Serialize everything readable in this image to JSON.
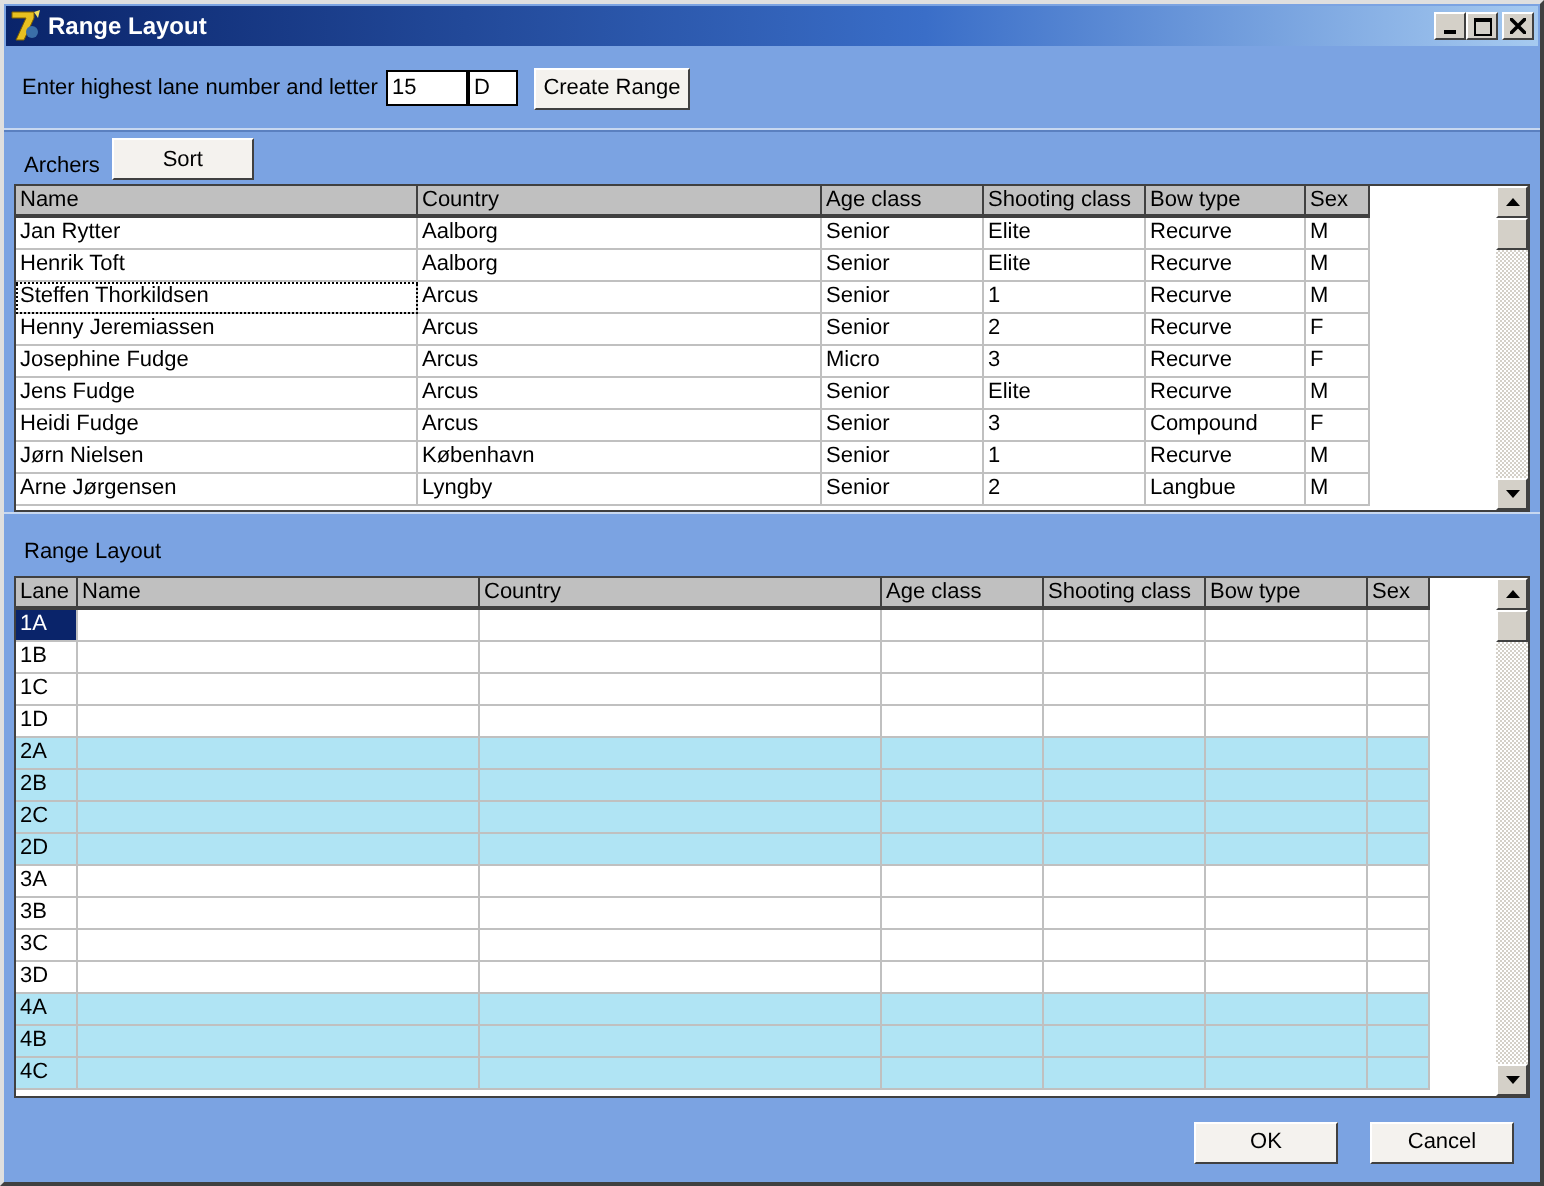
{
  "window": {
    "title": "Range Layout"
  },
  "range_input": {
    "label": "Enter highest lane number and letter",
    "number": "15",
    "letter": "D",
    "button": "Create Range"
  },
  "archers": {
    "label": "Archers",
    "sort_button": "Sort",
    "columns": [
      "Name",
      "Country",
      "Age class",
      "Shooting class",
      "Bow type",
      "Sex"
    ],
    "rows": [
      {
        "cells": [
          "Jan Rytter",
          "Aalborg",
          "Senior",
          "Elite",
          "Recurve",
          "M"
        ],
        "focused": false
      },
      {
        "cells": [
          "Henrik Toft",
          "Aalborg",
          "Senior",
          "Elite",
          "Recurve",
          "M"
        ],
        "focused": false
      },
      {
        "cells": [
          "Steffen Thorkildsen",
          "Arcus",
          "Senior",
          "1",
          "Recurve",
          "M"
        ],
        "focused": true
      },
      {
        "cells": [
          "Henny Jeremiassen",
          "Arcus",
          "Senior",
          "2",
          "Recurve",
          "F"
        ],
        "focused": false
      },
      {
        "cells": [
          "Josephine Fudge",
          "Arcus",
          "Micro",
          "3",
          "Recurve",
          "F"
        ],
        "focused": false
      },
      {
        "cells": [
          "Jens Fudge",
          "Arcus",
          "Senior",
          "Elite",
          "Recurve",
          "M"
        ],
        "focused": false
      },
      {
        "cells": [
          "Heidi Fudge",
          "Arcus",
          "Senior",
          "3",
          "Compound",
          "F"
        ],
        "focused": false
      },
      {
        "cells": [
          "Jørn Nielsen",
          "København",
          "Senior",
          "1",
          "Recurve",
          "M"
        ],
        "focused": false
      },
      {
        "cells": [
          "Arne Jørgensen",
          "Lyngby",
          "Senior",
          "2",
          "Langbue",
          "M"
        ],
        "focused": false
      }
    ]
  },
  "range_layout": {
    "label": "Range Layout",
    "columns": [
      "Lane",
      "Name",
      "Country",
      "Age class",
      "Shooting class",
      "Bow type",
      "Sex"
    ],
    "rows": [
      {
        "lane": "1A",
        "selected": true,
        "shaded": false
      },
      {
        "lane": "1B",
        "selected": false,
        "shaded": false
      },
      {
        "lane": "1C",
        "selected": false,
        "shaded": false
      },
      {
        "lane": "1D",
        "selected": false,
        "shaded": false
      },
      {
        "lane": "2A",
        "selected": false,
        "shaded": true
      },
      {
        "lane": "2B",
        "selected": false,
        "shaded": true
      },
      {
        "lane": "2C",
        "selected": false,
        "shaded": true
      },
      {
        "lane": "2D",
        "selected": false,
        "shaded": true
      },
      {
        "lane": "3A",
        "selected": false,
        "shaded": false
      },
      {
        "lane": "3B",
        "selected": false,
        "shaded": false
      },
      {
        "lane": "3C",
        "selected": false,
        "shaded": false
      },
      {
        "lane": "3D",
        "selected": false,
        "shaded": false
      },
      {
        "lane": "4A",
        "selected": false,
        "shaded": true
      },
      {
        "lane": "4B",
        "selected": false,
        "shaded": true
      },
      {
        "lane": "4C",
        "selected": false,
        "shaded": true
      }
    ]
  },
  "buttons": [
    "OK",
    "Cancel"
  ]
}
